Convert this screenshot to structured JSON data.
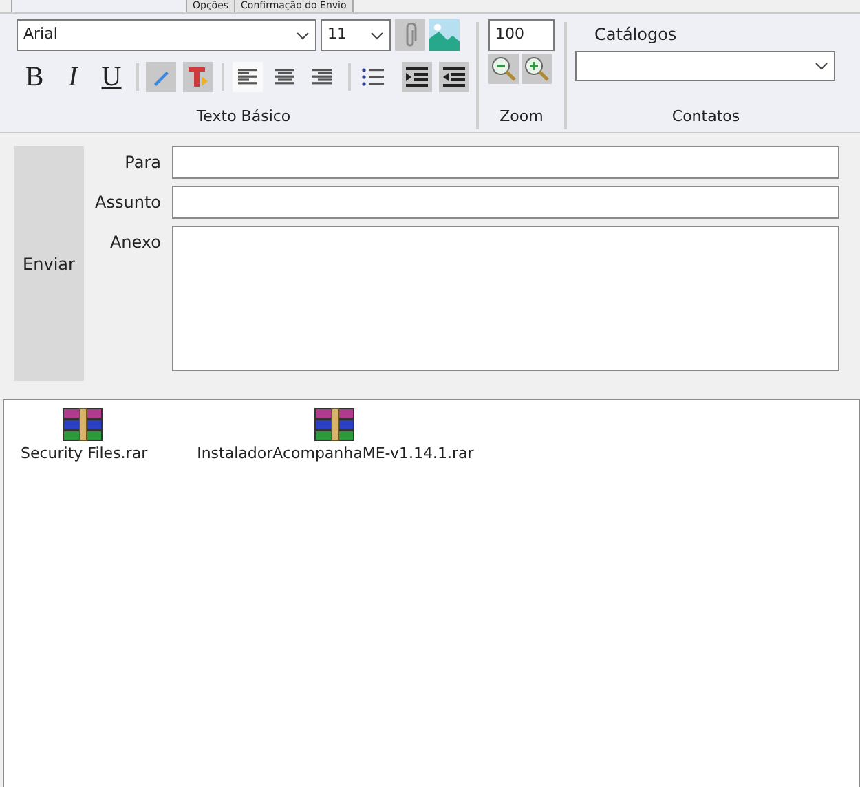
{
  "tabs": [
    {
      "label": "Opções",
      "selected": false
    },
    {
      "label": "Confirmação do Envio",
      "selected": false
    }
  ],
  "ribbon": {
    "font": {
      "value": "Arial"
    },
    "size": {
      "value": "11"
    },
    "style_buttons": [
      {
        "label": "B",
        "kind": "bold",
        "on": false
      },
      {
        "label": "I",
        "kind": "italic",
        "on": false
      },
      {
        "label": "U",
        "kind": "underline",
        "on": false
      }
    ],
    "align_buttons": [
      {
        "kind": "left",
        "selected": true
      },
      {
        "kind": "center",
        "selected": false
      },
      {
        "kind": "right",
        "selected": false
      }
    ],
    "groups": [
      "Texto Básico",
      "Zoom",
      "Contatos"
    ],
    "zoom": {
      "value": "100"
    },
    "catalogs": {
      "label": "Catálogos"
    }
  },
  "compose": {
    "send": "Enviar",
    "fields": [
      {
        "label": "Para",
        "kind": "line"
      },
      {
        "label": "Assunto",
        "kind": "line"
      },
      {
        "label": "Anexo",
        "kind": "area"
      }
    ]
  },
  "attachments": [
    {
      "name": "Security Files.rar"
    },
    {
      "name": "InstaladorAcompanhaME-v1.14.1.rar"
    }
  ]
}
